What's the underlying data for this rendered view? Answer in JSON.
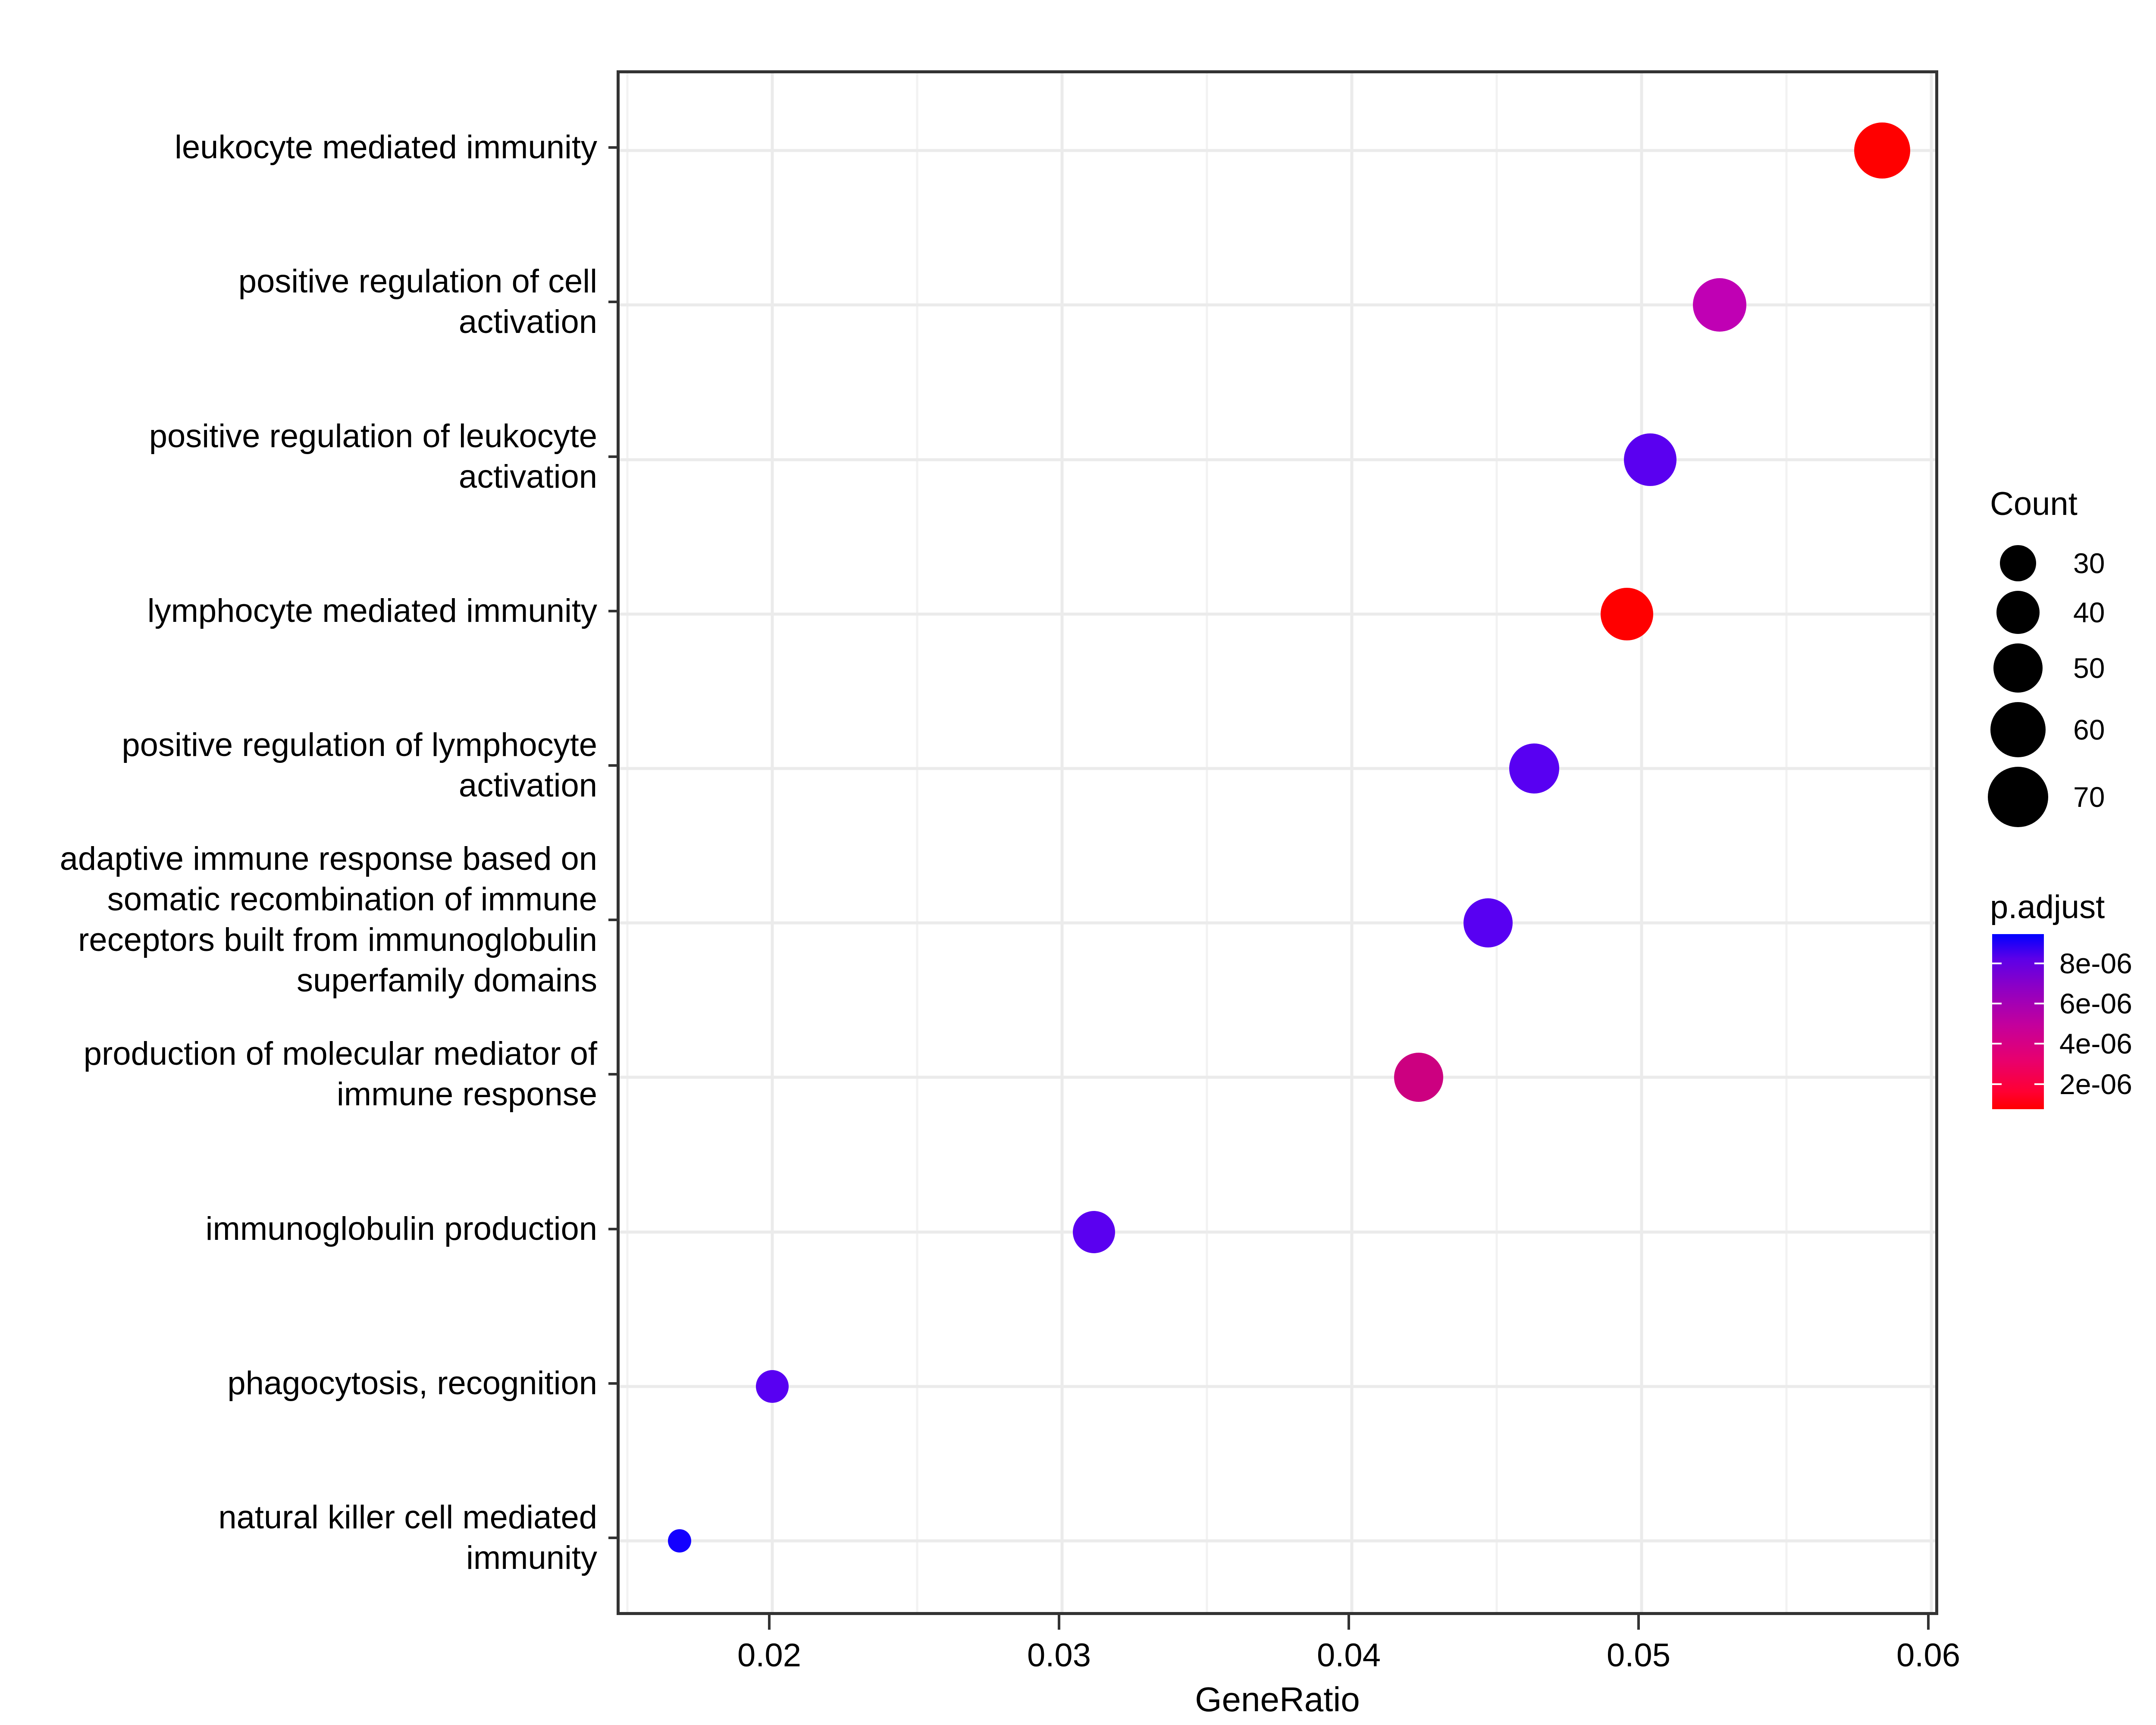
{
  "chart_data": {
    "type": "scatter",
    "title": "",
    "xlabel": "GeneRatio",
    "ylabel": "",
    "xlim": [
      0.0155,
      0.0605
    ],
    "grid": true,
    "x_ticks": [
      "0.02",
      "0.03",
      "0.04",
      "0.05",
      "0.06"
    ],
    "x_tick_values": [
      0.02,
      0.03,
      0.04,
      0.05,
      0.06
    ],
    "categories": [
      "leukocyte mediated immunity",
      "positive regulation of cell\nactivation",
      "positive regulation of leukocyte\nactivation",
      "lymphocyte mediated immunity",
      "positive regulation of lymphocyte\nactivation",
      "adaptive immune response based on\nsomatic recombination of immune\nreceptors built from immunoglobulin\nsuperfamily domains",
      "production of molecular mediator of\nimmune response",
      "immunoglobulin production",
      "phagocytosis, recognition",
      "natural killer cell mediated\nimmunity"
    ],
    "points": [
      {
        "label": "leukocyte mediated immunity",
        "gene_ratio": 0.0583,
        "count": 72,
        "p_adjust": 1.2e-06,
        "color": "#ff0000",
        "radius": 65
      },
      {
        "label": "positive regulation of cell activation",
        "gene_ratio": 0.0527,
        "count": 65,
        "p_adjust": 4.2e-06,
        "color": "#c000b4",
        "radius": 62
      },
      {
        "label": "positive regulation of leukocyte activation",
        "gene_ratio": 0.0503,
        "count": 62,
        "p_adjust": 7.3e-06,
        "color": "#5a00f0",
        "radius": 61
      },
      {
        "label": "lymphocyte mediated immunity",
        "gene_ratio": 0.0495,
        "count": 61,
        "p_adjust": 1.3e-06,
        "color": "#ff0000",
        "radius": 61
      },
      {
        "label": "positive regulation of lymphocyte activation",
        "gene_ratio": 0.0463,
        "count": 57,
        "p_adjust": 7.7e-06,
        "color": "#5800f2",
        "radius": 58
      },
      {
        "label": "adaptive immune response based on somatic recombination of immune receptors built from immunoglobulin superfamily domains",
        "gene_ratio": 0.0447,
        "count": 55,
        "p_adjust": 7.8e-06,
        "color": "#5800f2",
        "radius": 57
      },
      {
        "label": "production of molecular mediator of immune response",
        "gene_ratio": 0.0423,
        "count": 52,
        "p_adjust": 3.3e-06,
        "color": "#cc0080",
        "radius": 57
      },
      {
        "label": "immunoglobulin production",
        "gene_ratio": 0.0311,
        "count": 38,
        "p_adjust": 7.5e-06,
        "color": "#5a00f0",
        "radius": 49
      },
      {
        "label": "phagocytosis, recognition",
        "gene_ratio": 0.02,
        "count": 25,
        "p_adjust": 7.6e-06,
        "color": "#5800f2",
        "radius": 38
      },
      {
        "label": "natural killer cell mediated immunity",
        "gene_ratio": 0.0168,
        "count": 21,
        "p_adjust": 9.2e-06,
        "color": "#1400ff",
        "radius": 27
      }
    ],
    "legends": {
      "size": {
        "title": "Count",
        "breaks": [
          30,
          40,
          50,
          60,
          70
        ],
        "labels": [
          "30",
          "40",
          "50",
          "60",
          "70"
        ],
        "radii": [
          42,
          50,
          57,
          64,
          70
        ]
      },
      "color": {
        "title": "p.adjust",
        "tick_labels": [
          "8e-06",
          "6e-06",
          "4e-06",
          "2e-06"
        ],
        "tick_values": [
          8e-06,
          6e-06,
          4e-06,
          2e-06
        ],
        "low_color": "#ff0000",
        "high_color": "#0000ff"
      }
    }
  },
  "axis": {
    "x_title": "GeneRatio"
  }
}
